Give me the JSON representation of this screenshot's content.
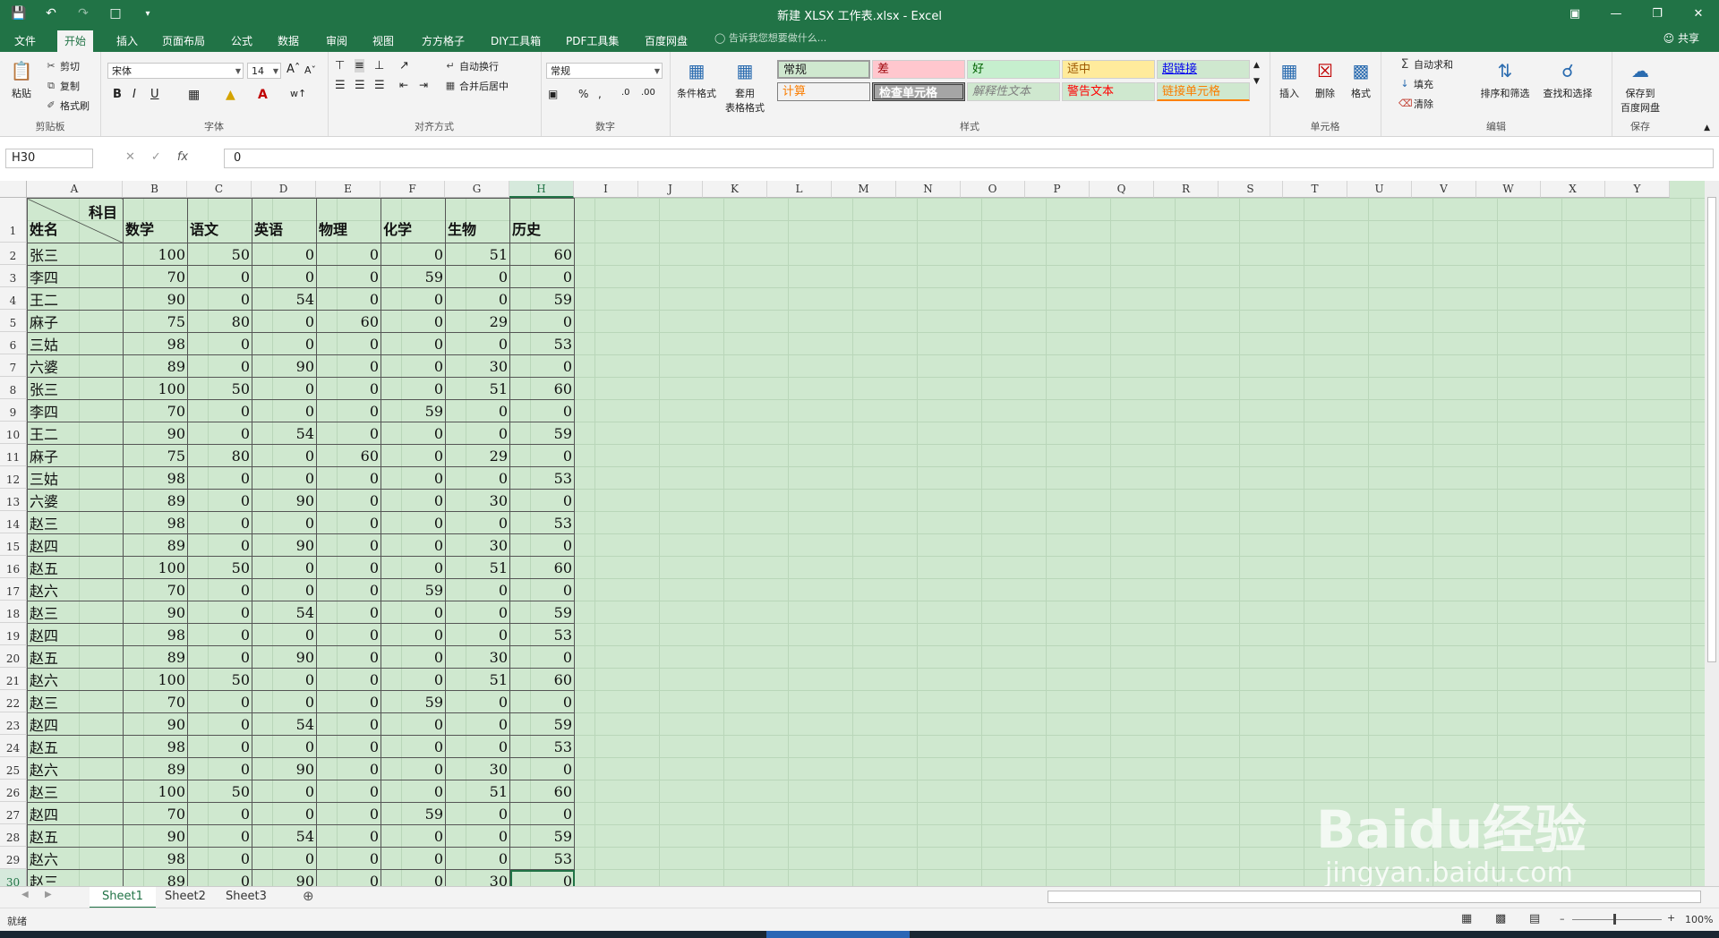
{
  "window": {
    "title": "新建 XLSX 工作表.xlsx - Excel"
  },
  "tabs": [
    "文件",
    "开始",
    "插入",
    "页面布局",
    "公式",
    "数据",
    "审阅",
    "视图",
    "方方格子",
    "DIY工具箱",
    "PDF工具集",
    "百度网盘"
  ],
  "tellme": "告诉我您想要做什么...",
  "share": "共享",
  "ribbon": {
    "clipboard": {
      "paste": "粘贴",
      "cut": "剪切",
      "copy": "复制",
      "painter": "格式刷",
      "label": "剪贴板"
    },
    "font": {
      "name": "宋体",
      "size": "14",
      "label": "字体",
      "bold": "B",
      "italic": "I",
      "underline": "U"
    },
    "alignment": {
      "wrap": "自动换行",
      "merge": "合并后居中",
      "label": "对齐方式"
    },
    "number": {
      "format": "常规",
      "label": "数字",
      "percent": "%"
    },
    "cond": {
      "line1": "条件格式",
      "line2": "套用",
      "line3": "表格格式"
    },
    "styles": {
      "label": "样式",
      "items": [
        "常规",
        "差",
        "好",
        "适中",
        "超链接",
        "计算",
        "检查单元格",
        "解释性文本",
        "警告文本",
        "链接单元格"
      ]
    },
    "cells": {
      "insert": "插入",
      "delete": "删除",
      "format": "格式",
      "label": "单元格"
    },
    "editing": {
      "autosum": "自动求和",
      "fill": "填充",
      "clear": "清除",
      "sort": "排序和筛选",
      "find": "查找和选择",
      "label": "编辑"
    },
    "save": {
      "line1": "保存到",
      "line2": "百度网盘",
      "label": "保存"
    }
  },
  "formula": {
    "namebox": "H30",
    "value": "0",
    "fx": "fx"
  },
  "columns": [
    "A",
    "B",
    "C",
    "D",
    "E",
    "F",
    "G",
    "H",
    "I",
    "J",
    "K",
    "L",
    "M",
    "N",
    "O",
    "P",
    "Q",
    "R",
    "S",
    "T",
    "U",
    "V",
    "W",
    "X",
    "Y"
  ],
  "header": {
    "diag_top": "科目",
    "diag_bottom": "姓名",
    "subjects": [
      "数学",
      "语文",
      "英语",
      "物理",
      "化学",
      "生物",
      "历史"
    ]
  },
  "rows": [
    [
      "张三",
      100,
      50,
      0,
      0,
      0,
      51,
      60
    ],
    [
      "李四",
      70,
      0,
      0,
      0,
      59,
      0,
      0
    ],
    [
      "王二",
      90,
      0,
      54,
      0,
      0,
      0,
      59
    ],
    [
      "麻子",
      75,
      80,
      0,
      60,
      0,
      29,
      0
    ],
    [
      "三姑",
      98,
      0,
      0,
      0,
      0,
      0,
      53
    ],
    [
      "六婆",
      89,
      0,
      90,
      0,
      0,
      30,
      0
    ],
    [
      "张三",
      100,
      50,
      0,
      0,
      0,
      51,
      60
    ],
    [
      "李四",
      70,
      0,
      0,
      0,
      59,
      0,
      0
    ],
    [
      "王二",
      90,
      0,
      54,
      0,
      0,
      0,
      59
    ],
    [
      "麻子",
      75,
      80,
      0,
      60,
      0,
      29,
      0
    ],
    [
      "三姑",
      98,
      0,
      0,
      0,
      0,
      0,
      53
    ],
    [
      "六婆",
      89,
      0,
      90,
      0,
      0,
      30,
      0
    ],
    [
      "赵三",
      98,
      0,
      0,
      0,
      0,
      0,
      53
    ],
    [
      "赵四",
      89,
      0,
      90,
      0,
      0,
      30,
      0
    ],
    [
      "赵五",
      100,
      50,
      0,
      0,
      0,
      51,
      60
    ],
    [
      "赵六",
      70,
      0,
      0,
      0,
      59,
      0,
      0
    ],
    [
      "赵三",
      90,
      0,
      54,
      0,
      0,
      0,
      59
    ],
    [
      "赵四",
      98,
      0,
      0,
      0,
      0,
      0,
      53
    ],
    [
      "赵五",
      89,
      0,
      90,
      0,
      0,
      30,
      0
    ],
    [
      "赵六",
      100,
      50,
      0,
      0,
      0,
      51,
      60
    ],
    [
      "赵三",
      70,
      0,
      0,
      0,
      59,
      0,
      0
    ],
    [
      "赵四",
      90,
      0,
      54,
      0,
      0,
      0,
      59
    ],
    [
      "赵五",
      98,
      0,
      0,
      0,
      0,
      0,
      53
    ],
    [
      "赵六",
      89,
      0,
      90,
      0,
      0,
      30,
      0
    ],
    [
      "赵三",
      100,
      50,
      0,
      0,
      0,
      51,
      60
    ],
    [
      "赵四",
      70,
      0,
      0,
      0,
      59,
      0,
      0
    ],
    [
      "赵五",
      90,
      0,
      54,
      0,
      0,
      0,
      59
    ],
    [
      "赵六",
      98,
      0,
      0,
      0,
      0,
      0,
      53
    ],
    [
      "赵三",
      89,
      0,
      90,
      0,
      0,
      30,
      0
    ]
  ],
  "sheets": [
    "Sheet1",
    "Sheet2",
    "Sheet3"
  ],
  "status": {
    "ready": "就绪",
    "zoom": "100%"
  },
  "watermark": {
    "logo": "Baidu经验",
    "url": "jingyan.baidu.com"
  },
  "colors": {
    "accent": "#217346",
    "sheet_bg": "#cfe8cf"
  }
}
